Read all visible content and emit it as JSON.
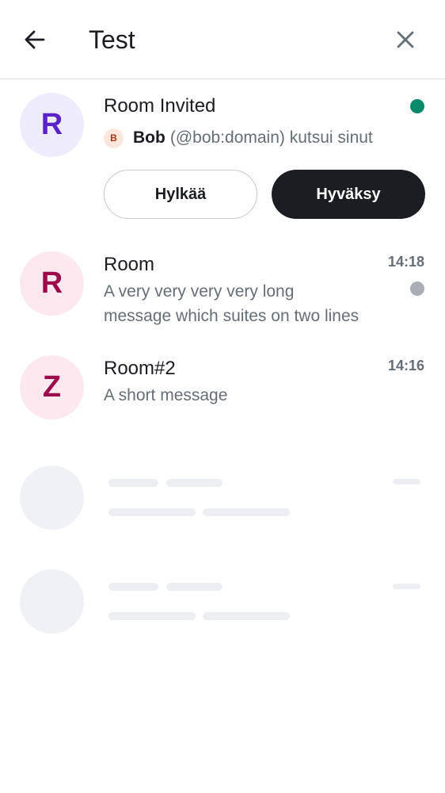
{
  "header": {
    "title": "Test",
    "back_icon": "arrow-left-icon",
    "close_icon": "close-icon"
  },
  "invite": {
    "avatar_letter": "R",
    "room_name": "Room Invited",
    "inviter_avatar_letter": "B",
    "inviter_name": "Bob",
    "inviter_text": "(@bob:domain) kutsui sinut",
    "decline_label": "Hylkää",
    "accept_label": "Hyväksy",
    "indicator_color": "#0b8a6b"
  },
  "rooms": [
    {
      "avatar_letter": "R",
      "name": "Room",
      "time": "14:18",
      "preview_line1": "A very very very very long",
      "preview_line2": "message which suites on two lines",
      "unread_color": "#a8adb6"
    },
    {
      "avatar_letter": "Z",
      "name": "Room#2",
      "time": "14:16",
      "preview_line1": "A short message"
    }
  ],
  "colors": {
    "invite_avatar_bg": "#eeebfd",
    "invite_avatar_fg": "#5a22c7",
    "room_avatar_bg": "#fde8ef",
    "room_avatar_fg": "#9b0b4b",
    "accent_dark": "#1b1d22"
  }
}
